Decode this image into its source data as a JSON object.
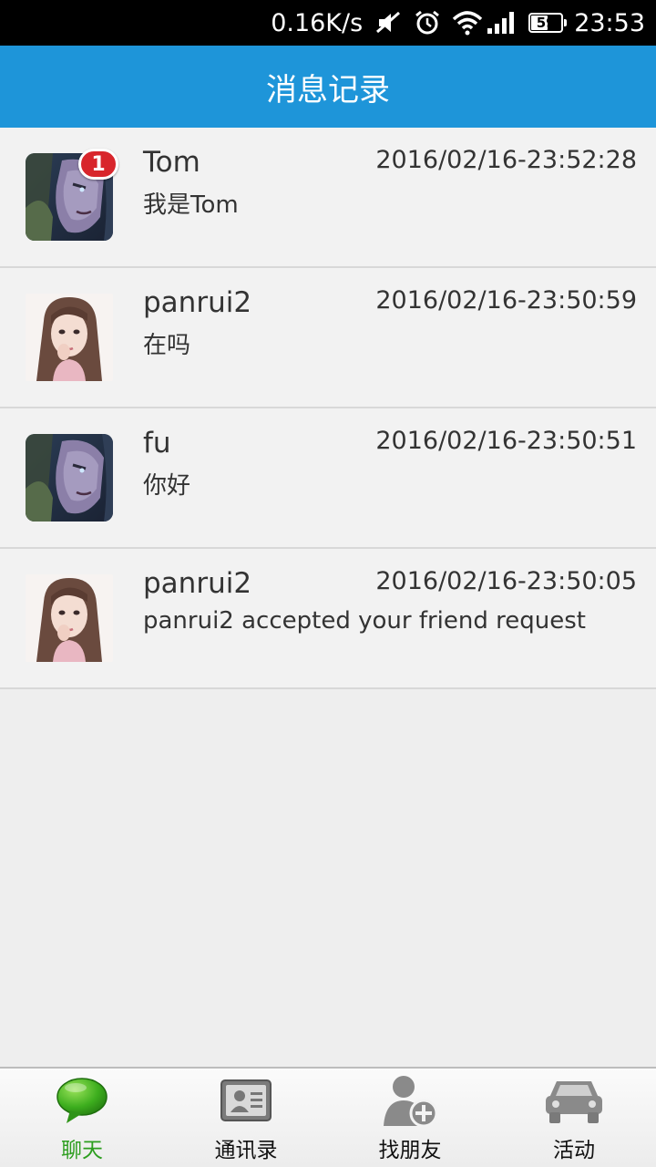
{
  "status_bar": {
    "net_speed": "0.16K/s",
    "battery_level": "59",
    "time": "23:53"
  },
  "header": {
    "title": "消息记录"
  },
  "conversations": [
    {
      "name": "Tom",
      "time": "2016/02/16-23:52:28",
      "message": "我是Tom",
      "avatar": "warrior-avatar",
      "unread": "1"
    },
    {
      "name": "panrui2",
      "time": "2016/02/16-23:50:59",
      "message": "在吗",
      "avatar": "girl-avatar"
    },
    {
      "name": "fu",
      "time": "2016/02/16-23:50:51",
      "message": "你好",
      "avatar": "warrior-avatar"
    },
    {
      "name": "panrui2",
      "time": "2016/02/16-23:50:05",
      "message": "panrui2 accepted your friend request",
      "avatar": "girl-avatar"
    }
  ],
  "tabs": [
    {
      "label": "聊天",
      "icon": "chat-bubble-icon",
      "active": true
    },
    {
      "label": "通讯录",
      "icon": "contact-card-icon",
      "active": false
    },
    {
      "label": "找朋友",
      "icon": "add-friend-icon",
      "active": false
    },
    {
      "label": "活动",
      "icon": "car-icon",
      "active": false
    }
  ],
  "colors": {
    "header_bg": "#1e95d9",
    "active_tab": "#2d9e1f",
    "badge": "#d8262c"
  }
}
